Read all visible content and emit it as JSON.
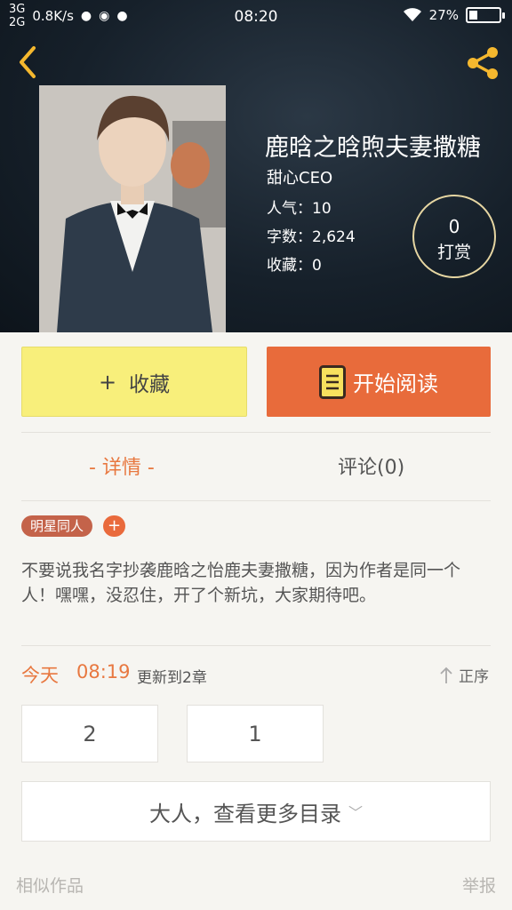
{
  "status_bar": {
    "network_top": "3G",
    "network_bottom": "2G",
    "speed": "0.8K/s",
    "time": "08:20",
    "battery": "27%",
    "battery_level": 0.27
  },
  "book": {
    "title": "鹿晗之晗煦夫妻撒糖",
    "author": "甜心CEO",
    "popularity": "人气：10",
    "word_count": "字数：2,624",
    "favorites": "收藏：0",
    "tip_count": "0",
    "tip_label": "打赏"
  },
  "actions": {
    "collect_label": "收藏",
    "read_label": "开始阅读"
  },
  "tabs": {
    "detail": "- 详情 -",
    "comments": "评论(0)"
  },
  "tags": [
    "明星同人"
  ],
  "description": "不要说我名字抄袭鹿晗之怡鹿夫妻撒糖，因为作者是同一个人！嘿嘿，没忍住，开了个新坑，大家期待吧。",
  "update": {
    "day": "今天",
    "time": "08:19",
    "text": "更新到2章",
    "sort_label": "正序"
  },
  "chapters": [
    "2",
    "1"
  ],
  "more_toc_label": "大人，查看更多目录",
  "footer": {
    "similar": "相似作品",
    "report": "举报"
  },
  "colors": {
    "accent_orange": "#e86b3b",
    "collect_yellow": "#f8ef7b",
    "tag_brown": "#c4634a",
    "icon_gold": "#f5b82e"
  }
}
